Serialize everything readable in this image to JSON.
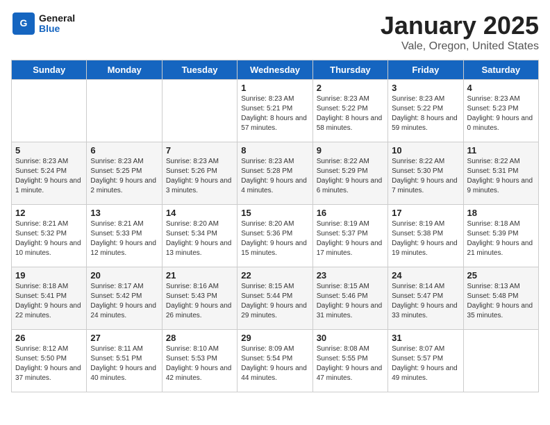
{
  "header": {
    "logo_line1": "General",
    "logo_line2": "Blue",
    "month": "January 2025",
    "location": "Vale, Oregon, United States"
  },
  "weekdays": [
    "Sunday",
    "Monday",
    "Tuesday",
    "Wednesday",
    "Thursday",
    "Friday",
    "Saturday"
  ],
  "weeks": [
    [
      {
        "day": "",
        "info": ""
      },
      {
        "day": "",
        "info": ""
      },
      {
        "day": "",
        "info": ""
      },
      {
        "day": "1",
        "info": "Sunrise: 8:23 AM\nSunset: 5:21 PM\nDaylight: 8 hours and 57 minutes."
      },
      {
        "day": "2",
        "info": "Sunrise: 8:23 AM\nSunset: 5:22 PM\nDaylight: 8 hours and 58 minutes."
      },
      {
        "day": "3",
        "info": "Sunrise: 8:23 AM\nSunset: 5:22 PM\nDaylight: 8 hours and 59 minutes."
      },
      {
        "day": "4",
        "info": "Sunrise: 8:23 AM\nSunset: 5:23 PM\nDaylight: 9 hours and 0 minutes."
      }
    ],
    [
      {
        "day": "5",
        "info": "Sunrise: 8:23 AM\nSunset: 5:24 PM\nDaylight: 9 hours and 1 minute."
      },
      {
        "day": "6",
        "info": "Sunrise: 8:23 AM\nSunset: 5:25 PM\nDaylight: 9 hours and 2 minutes."
      },
      {
        "day": "7",
        "info": "Sunrise: 8:23 AM\nSunset: 5:26 PM\nDaylight: 9 hours and 3 minutes."
      },
      {
        "day": "8",
        "info": "Sunrise: 8:23 AM\nSunset: 5:28 PM\nDaylight: 9 hours and 4 minutes."
      },
      {
        "day": "9",
        "info": "Sunrise: 8:22 AM\nSunset: 5:29 PM\nDaylight: 9 hours and 6 minutes."
      },
      {
        "day": "10",
        "info": "Sunrise: 8:22 AM\nSunset: 5:30 PM\nDaylight: 9 hours and 7 minutes."
      },
      {
        "day": "11",
        "info": "Sunrise: 8:22 AM\nSunset: 5:31 PM\nDaylight: 9 hours and 9 minutes."
      }
    ],
    [
      {
        "day": "12",
        "info": "Sunrise: 8:21 AM\nSunset: 5:32 PM\nDaylight: 9 hours and 10 minutes."
      },
      {
        "day": "13",
        "info": "Sunrise: 8:21 AM\nSunset: 5:33 PM\nDaylight: 9 hours and 12 minutes."
      },
      {
        "day": "14",
        "info": "Sunrise: 8:20 AM\nSunset: 5:34 PM\nDaylight: 9 hours and 13 minutes."
      },
      {
        "day": "15",
        "info": "Sunrise: 8:20 AM\nSunset: 5:36 PM\nDaylight: 9 hours and 15 minutes."
      },
      {
        "day": "16",
        "info": "Sunrise: 8:19 AM\nSunset: 5:37 PM\nDaylight: 9 hours and 17 minutes."
      },
      {
        "day": "17",
        "info": "Sunrise: 8:19 AM\nSunset: 5:38 PM\nDaylight: 9 hours and 19 minutes."
      },
      {
        "day": "18",
        "info": "Sunrise: 8:18 AM\nSunset: 5:39 PM\nDaylight: 9 hours and 21 minutes."
      }
    ],
    [
      {
        "day": "19",
        "info": "Sunrise: 8:18 AM\nSunset: 5:41 PM\nDaylight: 9 hours and 22 minutes."
      },
      {
        "day": "20",
        "info": "Sunrise: 8:17 AM\nSunset: 5:42 PM\nDaylight: 9 hours and 24 minutes."
      },
      {
        "day": "21",
        "info": "Sunrise: 8:16 AM\nSunset: 5:43 PM\nDaylight: 9 hours and 26 minutes."
      },
      {
        "day": "22",
        "info": "Sunrise: 8:15 AM\nSunset: 5:44 PM\nDaylight: 9 hours and 29 minutes."
      },
      {
        "day": "23",
        "info": "Sunrise: 8:15 AM\nSunset: 5:46 PM\nDaylight: 9 hours and 31 minutes."
      },
      {
        "day": "24",
        "info": "Sunrise: 8:14 AM\nSunset: 5:47 PM\nDaylight: 9 hours and 33 minutes."
      },
      {
        "day": "25",
        "info": "Sunrise: 8:13 AM\nSunset: 5:48 PM\nDaylight: 9 hours and 35 minutes."
      }
    ],
    [
      {
        "day": "26",
        "info": "Sunrise: 8:12 AM\nSunset: 5:50 PM\nDaylight: 9 hours and 37 minutes."
      },
      {
        "day": "27",
        "info": "Sunrise: 8:11 AM\nSunset: 5:51 PM\nDaylight: 9 hours and 40 minutes."
      },
      {
        "day": "28",
        "info": "Sunrise: 8:10 AM\nSunset: 5:53 PM\nDaylight: 9 hours and 42 minutes."
      },
      {
        "day": "29",
        "info": "Sunrise: 8:09 AM\nSunset: 5:54 PM\nDaylight: 9 hours and 44 minutes."
      },
      {
        "day": "30",
        "info": "Sunrise: 8:08 AM\nSunset: 5:55 PM\nDaylight: 9 hours and 47 minutes."
      },
      {
        "day": "31",
        "info": "Sunrise: 8:07 AM\nSunset: 5:57 PM\nDaylight: 9 hours and 49 minutes."
      },
      {
        "day": "",
        "info": ""
      }
    ]
  ]
}
